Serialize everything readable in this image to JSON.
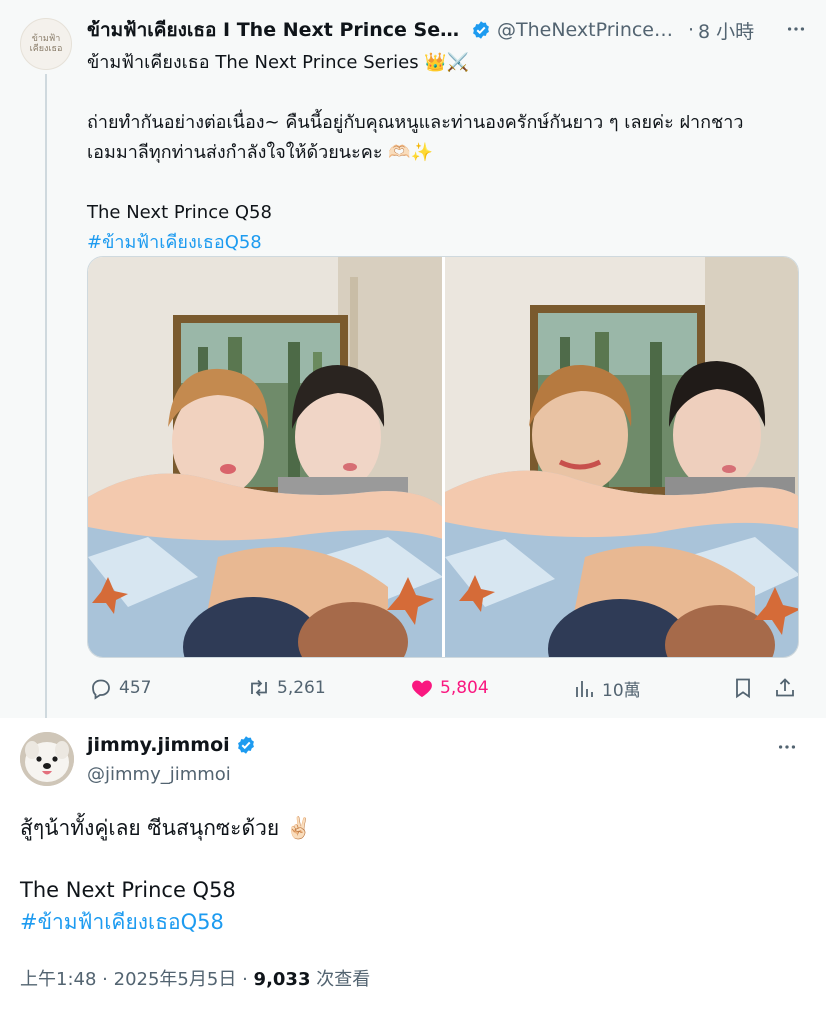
{
  "quoted": {
    "avatar_text": "ข้ามฟ้า เคียงเธอ",
    "name": "ข้ามฟ้าเคียงเธอ I The Next Prince Series",
    "handle": "@TheNextPrince_Series",
    "dot": "·",
    "time": "8 小時",
    "line1": "ข้ามฟ้าเคียงเธอ The Next Prince Series 👑⚔️",
    "line2": "ถ่ายทำกันอย่างต่อเนื่อง~ คืนนี้อยู่กับคุณหนูและท่านองครักษ์กันยาว ๆ เลยค่ะ ฝากชาว",
    "line3": "เอมมาลีทุกท่านส่งกำลังใจให้ด้วยนะคะ 🫶🏻✨",
    "line4": "The Next Prince Q58",
    "hashtag": "#ข้ามฟ้าเคียงเธอQ58",
    "stats": {
      "replies": "457",
      "reposts": "5,261",
      "likes": "5,804",
      "views": "10萬"
    }
  },
  "reply": {
    "name": "jimmy.jimmoi",
    "handle": "@jimmy_jimmoi",
    "text": "สู้ๆน้าทั้งคู่เลย ซีนสนุกซะด้วย ✌🏻",
    "line2": "The Next Prince Q58",
    "hashtag": "#ข้ามฟ้าเคียงเธอQ58",
    "time": "上午1:48",
    "sep": "·",
    "date": "2025年5月5日",
    "views_count": "9,033",
    "views_label": "次查看"
  },
  "colors": {
    "accent": "#1d9bf0",
    "like": "#f91880",
    "muted": "#536471"
  }
}
